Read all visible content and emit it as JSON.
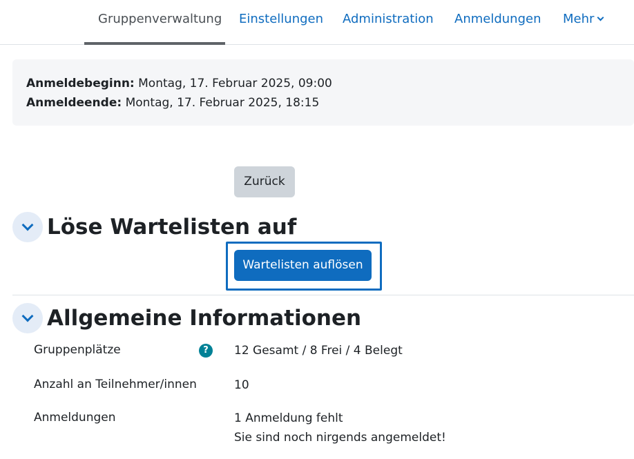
{
  "nav": {
    "tabs": [
      "Gruppenverwaltung",
      "Einstellungen",
      "Administration",
      "Anmeldungen",
      "Mehr"
    ],
    "active_tab": "Gruppenverwaltung"
  },
  "dates": {
    "start_label": "Anmeldebeginn:",
    "start_value": "Montag, 17. Februar 2025, 09:00",
    "end_label": "Anmeldeende:",
    "end_value": "Montag, 17. Februar 2025, 18:15"
  },
  "buttons": {
    "back": "Zurück",
    "resolve_waitlists": "Wartelisten auflösen"
  },
  "sections": {
    "waitlist_title": "Löse Wartelisten auf",
    "general_title": "Allgemeine Informationen"
  },
  "info": {
    "rows": [
      {
        "label": "Gruppenplätze",
        "value": "12 Gesamt / 8 Frei / 4 Belegt"
      },
      {
        "label": "Anzahl an Teilnehmer/innen",
        "value": "10"
      },
      {
        "label": "Anmeldungen",
        "value": "1 Anmeldung fehlt",
        "value2": "Sie sind noch nirgends angemeldet!"
      }
    ],
    "help_glyph": "?"
  },
  "icons": {
    "expand": "chevron-down-icon",
    "help": "question-circle-icon"
  },
  "colors": {
    "link": "#0f6cbf",
    "primary": "#0f6cbf",
    "secondary_button": "#ced4da",
    "help_badge": "#008196"
  }
}
